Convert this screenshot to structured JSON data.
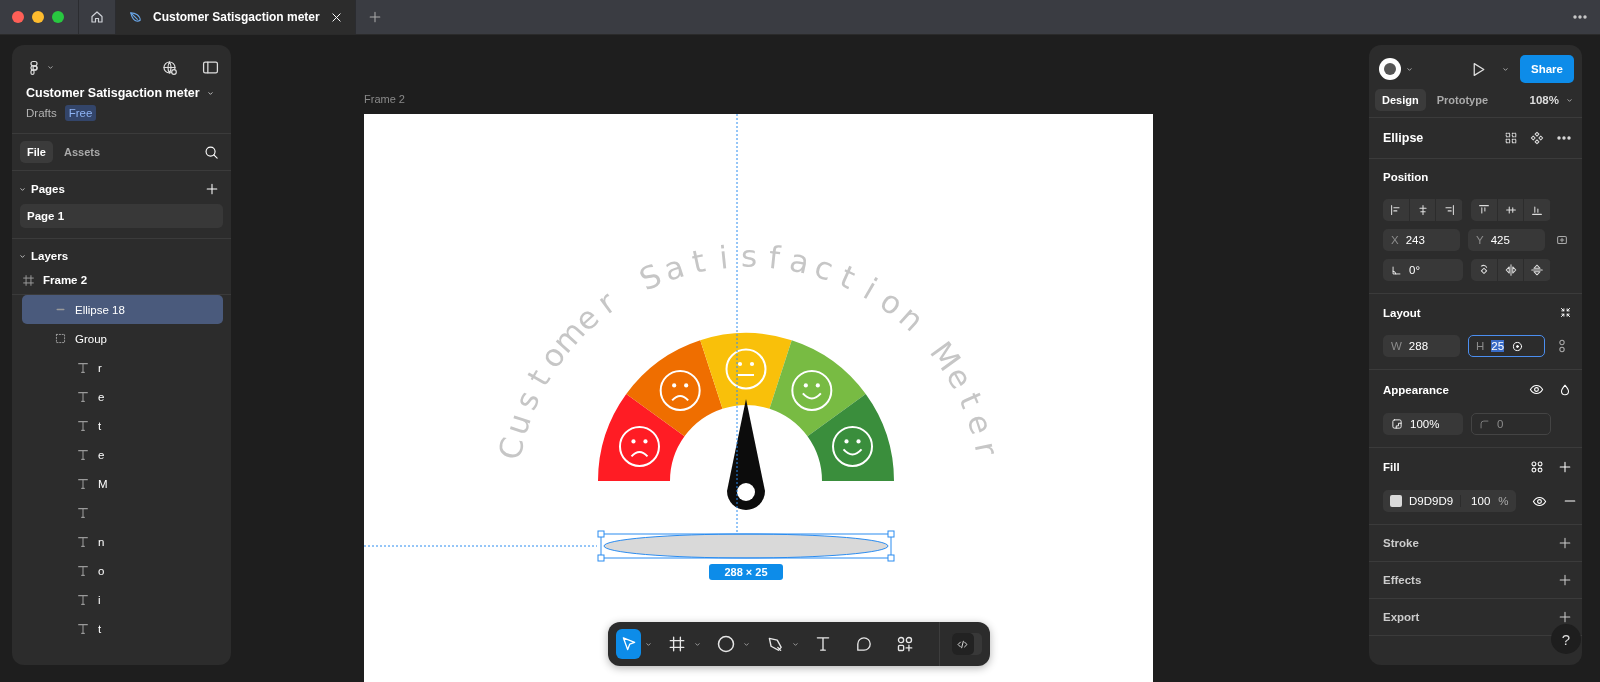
{
  "window": {
    "tabs": [
      {
        "kind": "home",
        "selected": false
      },
      {
        "kind": "file",
        "label": "Customer Satisgaction meter",
        "selected": true
      }
    ]
  },
  "file_header": {
    "name": "Customer Satisgaction meter",
    "location": "Drafts",
    "badge": "Free"
  },
  "left_tabs": [
    {
      "label": "File",
      "selected": true
    },
    {
      "label": "Assets",
      "selected": false
    }
  ],
  "pages": {
    "title": "Pages",
    "expanded": true,
    "items": [
      {
        "label": "Page 1",
        "selected": true
      }
    ]
  },
  "layers": {
    "title": "Layers",
    "expanded": true,
    "items": [
      {
        "kind": "frame",
        "label": "Frame 2",
        "selected": false,
        "children": [
          {
            "kind": "ellipse",
            "label": "Ellipse 18",
            "selected": true
          },
          {
            "kind": "group",
            "label": "Group",
            "selected": false,
            "children": [
              {
                "kind": "text",
                "label": "r",
                "selected": false
              },
              {
                "kind": "text",
                "label": "e",
                "selected": false
              },
              {
                "kind": "text",
                "label": "t",
                "selected": false
              },
              {
                "kind": "text",
                "label": "e",
                "selected": false
              },
              {
                "kind": "text",
                "label": "M",
                "selected": false
              },
              {
                "kind": "text",
                "selected": false
              },
              {
                "kind": "text",
                "label": "n",
                "selected": false
              },
              {
                "kind": "text",
                "label": "o",
                "selected": false
              },
              {
                "kind": "text",
                "label": "i",
                "selected": false
              },
              {
                "kind": "text",
                "label": "t",
                "selected": false
              }
            ]
          }
        ]
      }
    ]
  },
  "canvas": {
    "frame_label": "Frame 2",
    "artwork_title_words": [
      {
        "letters": [
          "C",
          "u",
          "s",
          "t",
          "o",
          "m",
          "e",
          "r"
        ]
      },
      {
        "letters": [
          "S",
          "a",
          "t",
          "i",
          "s",
          "f",
          "a",
          "c",
          "t",
          "i",
          "o",
          "n"
        ]
      },
      {
        "letters": [
          "M",
          "e",
          "t",
          "e",
          "r"
        ]
      }
    ],
    "selection_size": "288 × 25"
  },
  "toolbar": {
    "tools": [
      {
        "kind": "move",
        "selected": true,
        "menu": true
      },
      {
        "kind": "frame",
        "selected": false,
        "menu": true
      },
      {
        "kind": "ellipse",
        "selected": false,
        "menu": true
      },
      {
        "kind": "pen",
        "selected": false,
        "menu": true
      },
      {
        "kind": "text",
        "selected": false,
        "menu": false
      },
      {
        "kind": "comment",
        "selected": false,
        "menu": false
      },
      {
        "kind": "actions",
        "selected": false,
        "menu": false
      }
    ],
    "dev_mode": {
      "on": false
    }
  },
  "right": {
    "share": "Share",
    "tabs": [
      {
        "label": "Design",
        "selected": true
      },
      {
        "label": "Prototype",
        "selected": false
      }
    ],
    "zoom": "108%",
    "selection": "Ellipse",
    "position": {
      "title": "Position",
      "fields": [
        {
          "label": "X",
          "value": "243",
          "focused": false
        },
        {
          "label": "Y",
          "value": "425",
          "focused": false
        }
      ],
      "rotation": "0°"
    },
    "layout": {
      "title": "Layout",
      "fields": [
        {
          "label": "W",
          "value": "288",
          "focused": false
        },
        {
          "label": "H",
          "value": "25",
          "focused": true
        }
      ]
    },
    "appearance": {
      "title": "Appearance",
      "opacity": "100%",
      "radius": "0"
    },
    "fill": {
      "title": "Fill",
      "color": "#d9d9d9",
      "hex": "D9D9D9",
      "opacity": "100",
      "unit": "%"
    },
    "sections": [
      {
        "title": "Stroke"
      },
      {
        "title": "Effects"
      },
      {
        "title": "Export"
      }
    ]
  },
  "help": "?"
}
